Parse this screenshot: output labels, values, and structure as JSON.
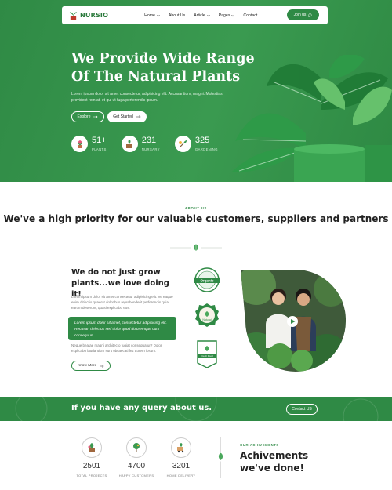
{
  "header": {
    "logo_text": "NURSIO",
    "menu": [
      {
        "label": "Home"
      },
      {
        "label": "About Us"
      },
      {
        "label": "Article"
      },
      {
        "label": "Pages"
      },
      {
        "label": "Contact"
      }
    ],
    "join_label": "Join us"
  },
  "hero": {
    "title": "We Provide Wide Range Of The Natural Plants",
    "text": "Lorem ipsum dolor sit amet consectetur, adipisicing elit. Accusantium, magni. Molestias provident rem at, et qui ut fuga perferendis ipsum.",
    "explore_label": "Explore",
    "started_label": "Get Started",
    "stats": [
      {
        "number": "51+",
        "label": "PLANTS"
      },
      {
        "number": "231",
        "label": "NURSARY"
      },
      {
        "number": "325",
        "label": "GARDENING"
      }
    ]
  },
  "about": {
    "kicker": "ABOUT US",
    "title": "We've a high priority for our valuable customers, suppliers and partners",
    "subtitle": "We do not just grow plants...we love doing it!",
    "para1": "Lorem ipsum dolor sit amet consectetur adipisicing elit. Ve eaque enim ditinctio quaerat doloribus reprehenderit perferendis quia earum deserunt, quasi explicabo eos.",
    "callout": "Lorem ipsum dolor sit amet, consectetur adipisicing elit. Recusan delectus sed dolor quod doloremque cum consequun.",
    "para2": "Neque beatae magni architecto fugiat consequatur? Dolor explicabo laudantium sunt obcaecati fez Lorem ipsum.",
    "more_label": "Know More",
    "badges": [
      "Organic",
      "Natural",
      "Fresh Food"
    ]
  },
  "cta": {
    "text": "If you have any query about us.",
    "button_label": "Contact US"
  },
  "counters": [
    {
      "number": "2501",
      "label": "TOTAL PROJECTS"
    },
    {
      "number": "4700",
      "label": "HAPPY CUSTOMERS"
    },
    {
      "number": "3201",
      "label": "HOME DELIVERY"
    }
  ],
  "achievements": {
    "kicker": "OUR ACHIVEMENTS",
    "title": "Achivements we've done!"
  },
  "colors": {
    "brand": "#2f8a45",
    "brand_dark": "#1f6e34",
    "leaf": "#5cb35f"
  },
  "icons": [
    "chevron-down-icon",
    "chat-icon",
    "arrow-right-icon",
    "leaf-icon",
    "play-icon"
  ]
}
